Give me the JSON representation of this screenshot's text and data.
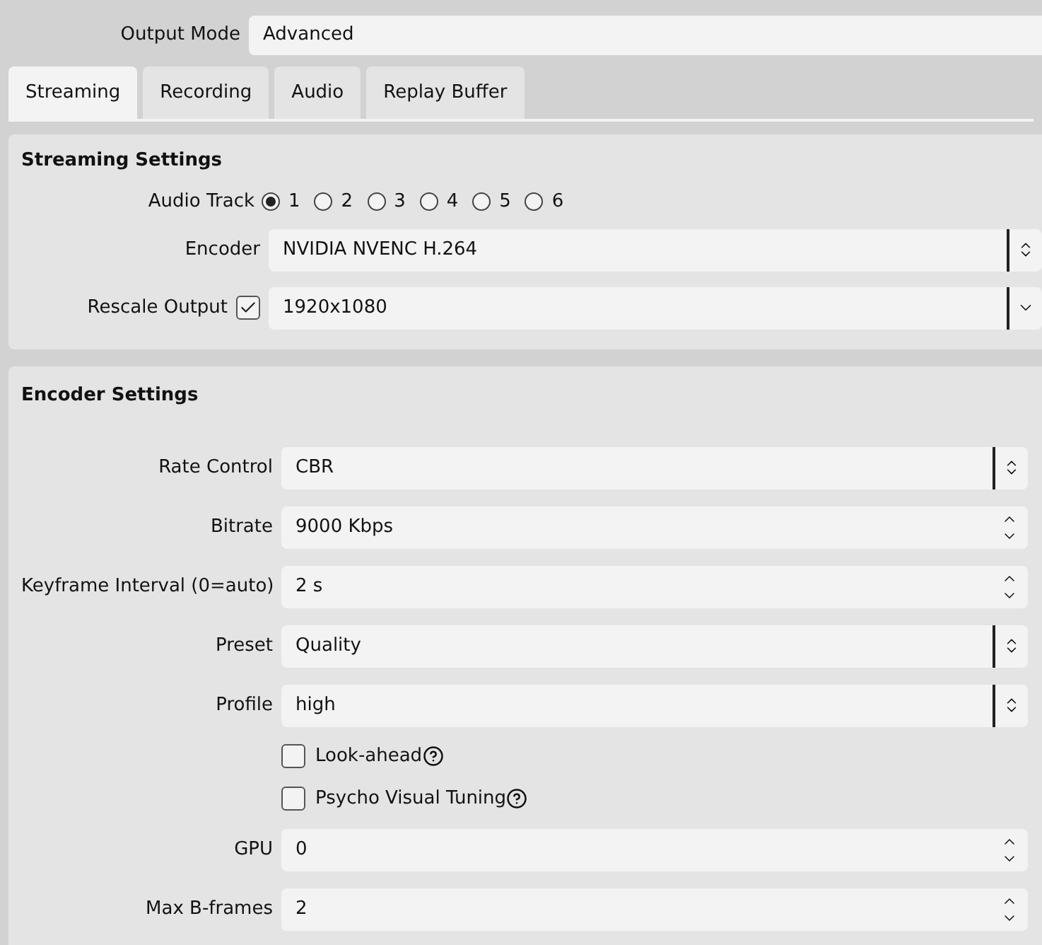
{
  "output_mode": {
    "label": "Output Mode",
    "value": "Advanced"
  },
  "tabs": [
    {
      "label": "Streaming",
      "selected": true
    },
    {
      "label": "Recording",
      "selected": false
    },
    {
      "label": "Audio",
      "selected": false
    },
    {
      "label": "Replay Buffer",
      "selected": false
    }
  ],
  "streaming_settings": {
    "title": "Streaming Settings",
    "audio_track": {
      "label": "Audio Track",
      "options": [
        {
          "label": "1",
          "selected": true
        },
        {
          "label": "2",
          "selected": false
        },
        {
          "label": "3",
          "selected": false
        },
        {
          "label": "4",
          "selected": false
        },
        {
          "label": "5",
          "selected": false
        },
        {
          "label": "6",
          "selected": false
        }
      ]
    },
    "encoder": {
      "label": "Encoder",
      "value": "NVIDIA NVENC H.264"
    },
    "rescale_output": {
      "label": "Rescale Output",
      "checked": true,
      "value": "1920x1080"
    }
  },
  "encoder_settings": {
    "title": "Encoder Settings",
    "rows": [
      {
        "kind": "combo",
        "label": "Rate Control",
        "value": "CBR"
      },
      {
        "kind": "spin",
        "label": "Bitrate",
        "value": "9000 Kbps"
      },
      {
        "kind": "spin",
        "label": "Keyframe Interval (0=auto)",
        "value": "2 s"
      },
      {
        "kind": "combo",
        "label": "Preset",
        "value": "Quality"
      },
      {
        "kind": "combo",
        "label": "Profile",
        "value": "high"
      },
      {
        "kind": "checkbox",
        "label": "Look-ahead",
        "checked": false
      },
      {
        "kind": "checkbox",
        "label": "Psycho Visual Tuning",
        "checked": false
      },
      {
        "kind": "spin",
        "label": "GPU",
        "value": "0"
      },
      {
        "kind": "spin",
        "label": "Max B-frames",
        "value": "2"
      }
    ]
  }
}
